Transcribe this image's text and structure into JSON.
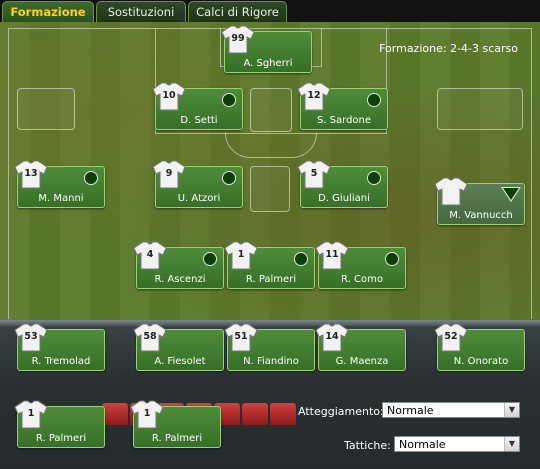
{
  "tabs": [
    {
      "label": "Formazione",
      "active": true
    },
    {
      "label": "Sostituzioni",
      "active": false
    },
    {
      "label": "Calci di Rigore",
      "active": false
    }
  ],
  "formation_label": "Formazione: 2-4-3 scarso",
  "pitch_players": [
    {
      "number": "99",
      "name": "A. Sgherri",
      "indicator": "none"
    },
    {
      "number": "10",
      "name": "D. Setti",
      "indicator": "dot"
    },
    {
      "number": "12",
      "name": "S. Sardone",
      "indicator": "dot"
    },
    {
      "number": "13",
      "name": "M. Manni",
      "indicator": "dot"
    },
    {
      "number": "9",
      "name": "U. Atzori",
      "indicator": "dot"
    },
    {
      "number": "5",
      "name": "D. Giuliani",
      "indicator": "dot"
    },
    {
      "number": "",
      "name": "M. Vannucch",
      "indicator": "triangle"
    },
    {
      "number": "4",
      "name": "R. Ascenzi",
      "indicator": "dot"
    },
    {
      "number": "1",
      "name": "R. Palmeri",
      "indicator": "dot"
    },
    {
      "number": "11",
      "name": "R. Como",
      "indicator": "dot"
    }
  ],
  "bench_players": [
    {
      "number": "53",
      "name": "R. Tremolad"
    },
    {
      "number": "58",
      "name": "A. Fiesolet"
    },
    {
      "number": "51",
      "name": "N. Fiandino"
    },
    {
      "number": "14",
      "name": "G. Maenza"
    },
    {
      "number": "52",
      "name": "N. Onorato"
    },
    {
      "number": "1",
      "name": "R. Palmeri"
    },
    {
      "number": "1",
      "name": "R. Palmeri"
    }
  ],
  "controls": {
    "attitude_label": "Atteggiamento:",
    "attitude_value": "Normale",
    "tactics_label": "Tattiche:",
    "tactics_value": "Normale"
  }
}
